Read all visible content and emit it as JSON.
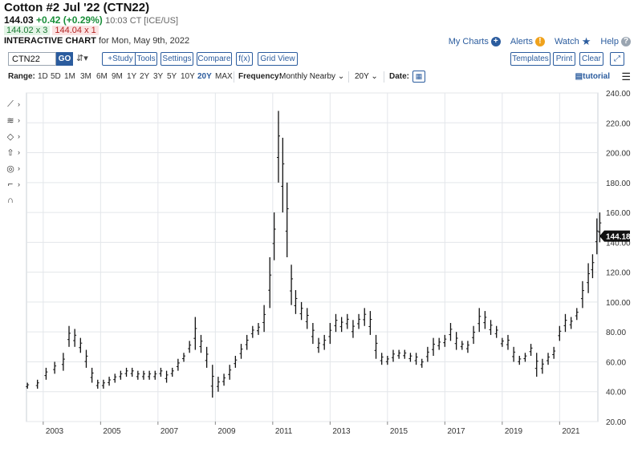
{
  "header": {
    "title": "Cotton #2 Jul '22 (CTN22)",
    "last": "144.03",
    "change": "+0.42 (+0.29%)",
    "time": "10:03 CT [ICE/US]",
    "bid": "144.02 x 3",
    "ask": "144.04 x 1",
    "chart_label": "INTERACTIVE CHART",
    "chart_date": "for Mon, May 9th, 2022"
  },
  "links": {
    "my_charts": "My Charts",
    "alerts": "Alerts",
    "watch": "Watch",
    "help": "Help"
  },
  "toolbar": {
    "symbol": "CTN22",
    "go": "GO",
    "bars_icon": "⇵▾",
    "study": "+Study",
    "tools": "Tools",
    "settings": "Settings",
    "compare": "Compare",
    "fx": "f(x)",
    "grid_view": "Grid View",
    "templates": "Templates",
    "print": "Print",
    "clear": "Clear",
    "expand": "⤢"
  },
  "rangebar": {
    "label": "Range:",
    "options": [
      "1D",
      "5D",
      "1M",
      "3M",
      "6M",
      "9M",
      "1Y",
      "2Y",
      "3Y",
      "5Y",
      "10Y",
      "20Y",
      "MAX"
    ],
    "active": "20Y",
    "frequency_label": "Frequency:",
    "frequency_value": "Monthly Nearby",
    "period_value": "20Y",
    "date_label": "Date:",
    "tutorial": "tutorial"
  },
  "colors": {
    "accent": "#2b5c9e",
    "positive": "#1a8f3a",
    "negative": "#b42323",
    "bars": "#111111",
    "grid": "#e3e6ea"
  },
  "chart_data": {
    "type": "ohlc",
    "title": "",
    "frequency": "monthly",
    "ylim": [
      20,
      240
    ],
    "yticks": [
      20,
      40,
      60,
      80,
      100,
      120,
      140,
      160,
      180,
      200,
      220,
      240
    ],
    "ytick_labels": [
      "20.00",
      "40.00",
      "60.00",
      "80.00",
      "100.00",
      "120.00",
      "140.00",
      "160.00",
      "180.00",
      "200.00",
      "220.00",
      "240.00"
    ],
    "xticks": [
      "2003",
      "2005",
      "2007",
      "2009",
      "2011",
      "2013",
      "2015",
      "2017",
      "2019",
      "2021"
    ],
    "x_start": "2002-06",
    "x_end": "2022-05",
    "last_price_label": "144.18",
    "last_price": 144.18,
    "series": [
      {
        "values": [
          [
            2002.45,
            46,
            42
          ],
          [
            2002.8,
            48,
            42
          ],
          [
            2003.1,
            56,
            48
          ],
          [
            2003.4,
            60,
            52
          ],
          [
            2003.7,
            66,
            54
          ],
          [
            2003.9,
            84,
            70
          ],
          [
            2004.1,
            82,
            70
          ],
          [
            2004.3,
            76,
            66
          ],
          [
            2004.5,
            68,
            56
          ],
          [
            2004.7,
            56,
            46
          ],
          [
            2004.9,
            48,
            42
          ],
          [
            2005.1,
            48,
            42
          ],
          [
            2005.3,
            50,
            44
          ],
          [
            2005.5,
            52,
            46
          ],
          [
            2005.7,
            54,
            48
          ],
          [
            2005.9,
            56,
            50
          ],
          [
            2006.1,
            56,
            50
          ],
          [
            2006.3,
            54,
            48
          ],
          [
            2006.5,
            54,
            48
          ],
          [
            2006.7,
            54,
            48
          ],
          [
            2006.9,
            54,
            48
          ],
          [
            2007.1,
            56,
            50
          ],
          [
            2007.3,
            54,
            46
          ],
          [
            2007.5,
            56,
            50
          ],
          [
            2007.7,
            62,
            54
          ],
          [
            2007.9,
            66,
            60
          ],
          [
            2008.1,
            74,
            66
          ],
          [
            2008.3,
            90,
            68
          ],
          [
            2008.5,
            78,
            66
          ],
          [
            2008.7,
            70,
            56
          ],
          [
            2008.9,
            58,
            36
          ],
          [
            2009.1,
            50,
            40
          ],
          [
            2009.3,
            52,
            44
          ],
          [
            2009.5,
            58,
            48
          ],
          [
            2009.7,
            64,
            56
          ],
          [
            2009.9,
            72,
            62
          ],
          [
            2010.1,
            78,
            68
          ],
          [
            2010.3,
            84,
            76
          ],
          [
            2010.5,
            86,
            78
          ],
          [
            2010.7,
            98,
            80
          ],
          [
            2010.9,
            130,
            96
          ],
          [
            2011.05,
            160,
            128
          ],
          [
            2011.2,
            228,
            180
          ],
          [
            2011.35,
            210,
            160
          ],
          [
            2011.5,
            180,
            130
          ],
          [
            2011.65,
            125,
            98
          ],
          [
            2011.8,
            108,
            92
          ],
          [
            2012.0,
            100,
            88
          ],
          [
            2012.2,
            96,
            82
          ],
          [
            2012.4,
            86,
            72
          ],
          [
            2012.6,
            76,
            66
          ],
          [
            2012.8,
            78,
            68
          ],
          [
            2013.0,
            86,
            72
          ],
          [
            2013.2,
            92,
            80
          ],
          [
            2013.4,
            90,
            80
          ],
          [
            2013.6,
            92,
            82
          ],
          [
            2013.8,
            88,
            76
          ],
          [
            2014.0,
            92,
            82
          ],
          [
            2014.2,
            96,
            84
          ],
          [
            2014.4,
            94,
            78
          ],
          [
            2014.6,
            78,
            62
          ],
          [
            2014.8,
            66,
            58
          ],
          [
            2015.0,
            64,
            58
          ],
          [
            2015.2,
            68,
            60
          ],
          [
            2015.4,
            68,
            62
          ],
          [
            2015.6,
            68,
            62
          ],
          [
            2015.8,
            66,
            60
          ],
          [
            2016.0,
            66,
            58
          ],
          [
            2016.2,
            62,
            56
          ],
          [
            2016.4,
            70,
            60
          ],
          [
            2016.6,
            76,
            64
          ],
          [
            2016.8,
            76,
            68
          ],
          [
            2017.0,
            78,
            70
          ],
          [
            2017.2,
            86,
            74
          ],
          [
            2017.4,
            80,
            68
          ],
          [
            2017.6,
            74,
            68
          ],
          [
            2017.8,
            74,
            66
          ],
          [
            2018.0,
            84,
            72
          ],
          [
            2018.2,
            96,
            80
          ],
          [
            2018.4,
            94,
            82
          ],
          [
            2018.6,
            88,
            78
          ],
          [
            2018.8,
            84,
            76
          ],
          [
            2019.0,
            76,
            70
          ],
          [
            2019.2,
            78,
            68
          ],
          [
            2019.4,
            70,
            60
          ],
          [
            2019.6,
            64,
            58
          ],
          [
            2019.8,
            66,
            60
          ],
          [
            2020.0,
            72,
            64
          ],
          [
            2020.2,
            66,
            50
          ],
          [
            2020.4,
            62,
            52
          ],
          [
            2020.6,
            66,
            58
          ],
          [
            2020.8,
            70,
            62
          ],
          [
            2021.0,
            84,
            74
          ],
          [
            2021.2,
            92,
            80
          ],
          [
            2021.4,
            90,
            82
          ],
          [
            2021.6,
            96,
            88
          ],
          [
            2021.8,
            114,
            96
          ],
          [
            2022.0,
            126,
            106
          ],
          [
            2022.15,
            132,
            116
          ],
          [
            2022.3,
            156,
            132
          ],
          [
            2022.4,
            160,
            140
          ]
        ]
      }
    ]
  }
}
